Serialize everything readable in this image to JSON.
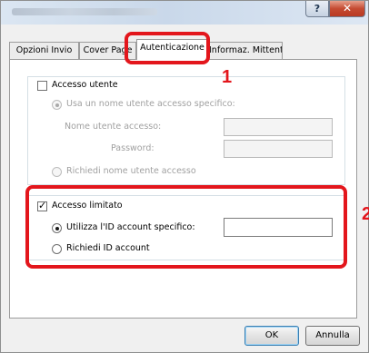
{
  "titlebar": {
    "help_glyph": "?",
    "close_glyph": "✕"
  },
  "tabs": [
    {
      "label": "Opzioni Invio"
    },
    {
      "label": "Cover Page"
    },
    {
      "label": "Autenticazione"
    },
    {
      "label": "Informaz. Mittente"
    }
  ],
  "user_access": {
    "checkbox_label": "Accesso utente",
    "checked": false,
    "radio_specific_label": "Usa un nome utente accesso specifico:",
    "username_label": "Nome utente accesso:",
    "username_value": "",
    "password_label": "Password:",
    "password_value": "",
    "radio_prompt_label": "Richiedi nome utente accesso"
  },
  "limited_access": {
    "checkbox_label": "Accesso limitato",
    "checked": true,
    "radio_specific_label": "Utilizza l'ID account specifico:",
    "account_id_value": "",
    "radio_prompt_label": "Richiedi ID account"
  },
  "footer": {
    "ok_label": "OK",
    "cancel_label": "Annulla"
  },
  "annotations": {
    "step1": "1",
    "step2": "2",
    "highlight_color": "#e3161c"
  }
}
